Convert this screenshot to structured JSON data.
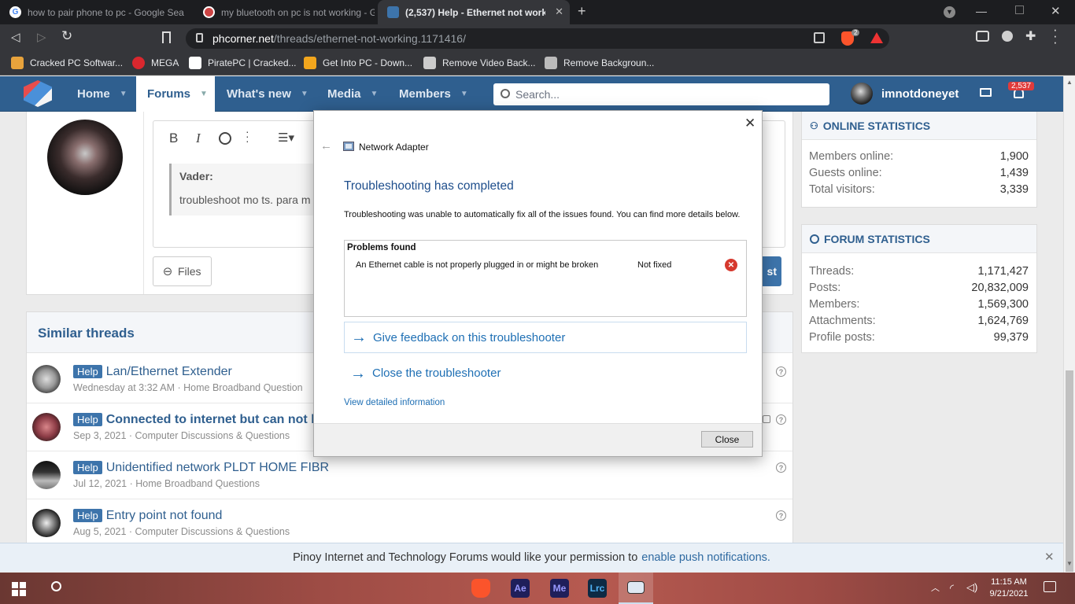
{
  "browser": {
    "tabs": [
      {
        "title": "how to pair phone to pc - Google Sea"
      },
      {
        "title": "my bluetooth on pc is not working - G"
      },
      {
        "title": "(2,537) Help - Ethernet not worki"
      }
    ],
    "new_tab_symbol": "+",
    "url_host": "phcorner.net",
    "url_path": "/threads/ethernet-not-working.1171416/",
    "shield_count": "2",
    "bookmarks": [
      {
        "label": "Cracked PC Softwar...",
        "color": "#e8a33c"
      },
      {
        "label": "MEGA",
        "color": "#d9272e"
      },
      {
        "label": "PiratePC | Cracked...",
        "color": "#ffffff"
      },
      {
        "label": "Get Into PC - Down...",
        "color": "#f2a61d"
      },
      {
        "label": "Remove Video Back...",
        "color": "#cccccc"
      },
      {
        "label": "Remove Backgroun...",
        "color": "#bbbbbb"
      }
    ]
  },
  "site": {
    "nav": [
      {
        "label": "Home"
      },
      {
        "label": "Forums"
      },
      {
        "label": "What's new"
      },
      {
        "label": "Media"
      },
      {
        "label": "Members"
      }
    ],
    "search_placeholder": "Search...",
    "username": "imnotdoneyet",
    "alert_count": "2,537",
    "accent": "#2f5f8f"
  },
  "editor": {
    "quote_author": "Vader:",
    "quote_text": "troubleshoot mo ts. para m",
    "files_button": "Files",
    "post_button_partial": "st"
  },
  "similar_threads": {
    "heading": "Similar threads",
    "prefix": "Help",
    "items": [
      {
        "title": "Lan/Ethernet Extender",
        "meta": "Wednesday at 3:32 AM · Home Broadband Question"
      },
      {
        "title": "Connected to internet but can not l",
        "meta": "Sep 3, 2021 · Computer Discussions & Questions"
      },
      {
        "title": "Unidentified network PLDT HOME FIBR",
        "meta": "Jul 12, 2021 · Home Broadband Questions"
      },
      {
        "title": "Entry point not found",
        "meta": "Aug 5, 2021 · Computer Discussions & Questions"
      }
    ]
  },
  "online_stats": {
    "heading": "ONLINE STATISTICS",
    "rows": [
      {
        "label": "Members online:",
        "value": "1,900"
      },
      {
        "label": "Guests online:",
        "value": "1,439"
      },
      {
        "label": "Total visitors:",
        "value": "3,339"
      }
    ]
  },
  "forum_stats": {
    "heading": "FORUM STATISTICS",
    "rows": [
      {
        "label": "Threads:",
        "value": "1,171,427"
      },
      {
        "label": "Posts:",
        "value": "20,832,009"
      },
      {
        "label": "Members:",
        "value": "1,569,300"
      },
      {
        "label": "Attachments:",
        "value": "1,624,769"
      },
      {
        "label": "Profile posts:",
        "value": "99,379"
      }
    ]
  },
  "dialog": {
    "title": "Network Adapter",
    "heading": "Troubleshooting has completed",
    "description": "Troubleshooting was unable to automatically fix all of the issues found. You can find more details below.",
    "problems_header": "Problems found",
    "problem": "An Ethernet cable is not properly plugged in or might be broken",
    "problem_status": "Not fixed",
    "feedback_link": "Give feedback on this troubleshooter",
    "close_link": "Close the troubleshooter",
    "details_link": "View detailed information",
    "close_button": "Close"
  },
  "notification": {
    "text": "Pinoy Internet and Technology Forums would like your permission to",
    "link": "enable push notifications."
  },
  "taskbar": {
    "apps": [
      {
        "label": "",
        "name": "brave",
        "color": "#fb542b"
      },
      {
        "label": "Ae",
        "name": "after-effects",
        "color": "#1f1f5a"
      },
      {
        "label": "Me",
        "name": "media-encoder",
        "color": "#1f1f5a"
      },
      {
        "label": "Lrc",
        "name": "lightroom",
        "color": "#0d2a44"
      },
      {
        "label": "",
        "name": "network-troubleshooter",
        "color": "#3a5f8a"
      }
    ],
    "time": "11:15 AM",
    "date": "9/21/2021"
  }
}
